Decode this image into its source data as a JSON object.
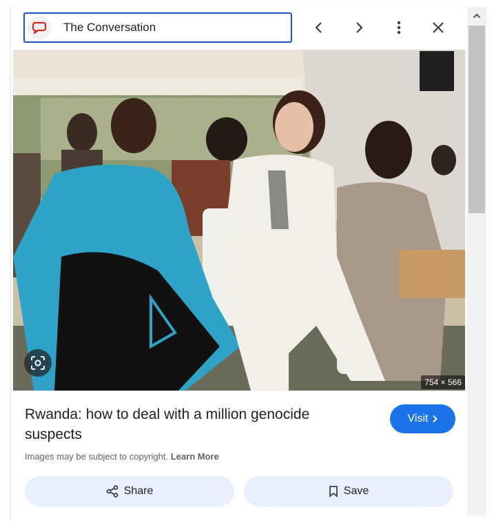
{
  "topbar": {
    "source_name": "The Conversation",
    "brand_color": "#d9291c"
  },
  "image": {
    "dimensions": "754 × 566",
    "description_icon": "google-lens-icon"
  },
  "result": {
    "title": "Rwanda: how to deal with a million genocide suspects",
    "visit_label": "Visit",
    "copyright_text": "Images may be subject to copyright.",
    "learn_more": "Learn More"
  },
  "actions": {
    "share_label": "Share",
    "save_label": "Save"
  },
  "colors": {
    "accent": "#1a73e8",
    "focus_border": "#1a56c9",
    "action_bg": "#e8f0fe"
  }
}
